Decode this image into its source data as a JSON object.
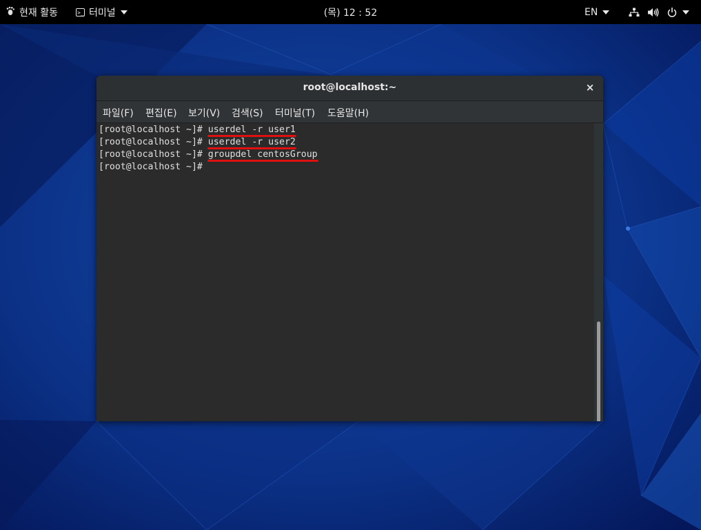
{
  "topbar": {
    "activities_label": "현재 활동",
    "app_menu_label": "터미널",
    "clock": "(목) 12 : 52",
    "language": "EN"
  },
  "icons": {
    "activities": "gnome-foot-icon",
    "app_menu": "terminal-icon",
    "network": "network-wired-icon",
    "volume": "volume-icon",
    "power": "power-icon"
  },
  "window": {
    "title": "root@localhost:~",
    "close_glyph": "×",
    "menu": [
      "파일(F)",
      "편집(E)",
      "보기(V)",
      "검색(S)",
      "터미널(T)",
      "도움말(H)"
    ]
  },
  "terminal": {
    "lines": [
      {
        "prompt": "[root@localhost ~]# ",
        "command": "userdel -r user1"
      },
      {
        "prompt": "[root@localhost ~]# ",
        "command": "userdel -r user2"
      },
      {
        "prompt": "[root@localhost ~]# ",
        "command": "groupdel centosGroup"
      },
      {
        "prompt": "[root@localhost ~]# ",
        "command": ""
      }
    ]
  },
  "colors": {
    "desktop_bg": "#0a2a6e",
    "annotation_underline": "#e01010",
    "terminal_bg": "#2b2b2b"
  }
}
